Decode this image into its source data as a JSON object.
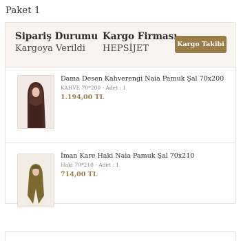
{
  "package": {
    "title": "Paket 1"
  },
  "status": {
    "order_label": "Sipariş Durumu",
    "order_value": "Kargoya Verildi",
    "carrier_label": "Kargo Firması",
    "carrier_value": "HEPSİJET",
    "track_button": "Kargo Takibi"
  },
  "items": [
    {
      "title": "Dama Desen Kahverengi Naia Pamuk Şal 70x200",
      "meta": "KAHVE 70*200 - Adet : 1",
      "price": "1.194,00 TL",
      "image_icon": "brown-scarf-model-photo"
    },
    {
      "title": "İman Kare Haki Naia Pamuk Şal 70x210",
      "meta": "Haki 70*210 - Adet : 1",
      "price": "714,00 TL",
      "image_icon": "khaki-scarf-model-photo"
    }
  ],
  "colors": {
    "accent": "#9b7d4a",
    "header_bg": "#f7f4f1",
    "border": "#e6e2dc"
  }
}
